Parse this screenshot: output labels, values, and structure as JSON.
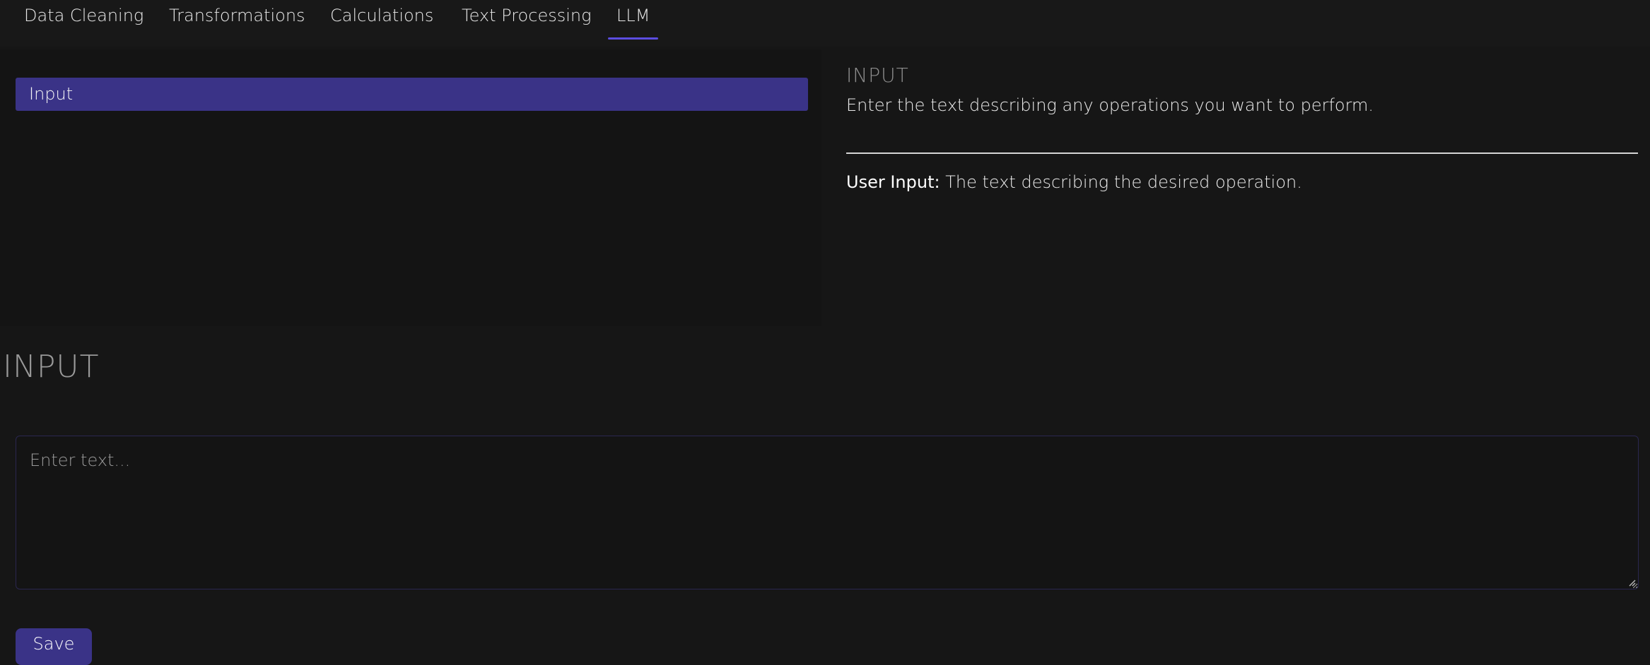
{
  "tabs": [
    {
      "label": "Data Cleaning",
      "active": false
    },
    {
      "label": "Transformations",
      "active": false
    },
    {
      "label": "Calculations",
      "active": false
    },
    {
      "label": "Text Processing",
      "active": false
    },
    {
      "label": "LLM",
      "active": true
    }
  ],
  "operation_list": {
    "items": [
      {
        "label": "Input",
        "selected": true
      }
    ]
  },
  "details": {
    "title": "INPUT",
    "description": "Enter the text describing any operations you want to perform.",
    "parameters": [
      {
        "name": "User Input:",
        "description": " The text describing the desired operation."
      }
    ]
  },
  "editor": {
    "title": "INPUT",
    "input_value": "",
    "input_placeholder": "Enter text...",
    "save_label": "Save"
  },
  "colors": {
    "background": "#161616",
    "accent": "#3a3387",
    "tab_underline": "#5b4de0"
  }
}
